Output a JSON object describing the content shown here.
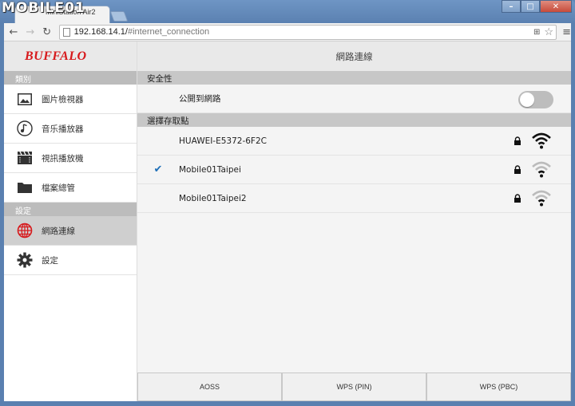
{
  "browser": {
    "watermark": "MOBILE01",
    "tab_title": "MiniStation Air2",
    "url_host": "192.168.14.1/",
    "url_path": "#internet_connection",
    "window_buttons": [
      "–",
      "□",
      "✕"
    ]
  },
  "sidebar": {
    "logo": "BUFFALO",
    "section_media": "類別",
    "section_settings": "設定",
    "items": [
      {
        "label": "圖片檢視器",
        "icon": "image-icon"
      },
      {
        "label": "音乐播放器",
        "icon": "music-note-icon"
      },
      {
        "label": "視訊播放機",
        "icon": "film-clapper-icon"
      },
      {
        "label": "檔案總管",
        "icon": "folder-icon"
      },
      {
        "label": "網路連線",
        "icon": "globe-icon",
        "active": true
      },
      {
        "label": "設定",
        "icon": "gear-icon"
      }
    ]
  },
  "main": {
    "title": "網路連線",
    "security_head": "安全性",
    "public_label": "公開到網路",
    "public_enabled": false,
    "ap_head": "選擇存取點",
    "access_points": [
      {
        "ssid": "HUAWEI-E5372-6F2C",
        "selected": false,
        "secured": true,
        "signal_bars": 3
      },
      {
        "ssid": "Mobile01Taipei",
        "selected": true,
        "secured": true,
        "signal_bars": 1
      },
      {
        "ssid": "Mobile01Taipei2",
        "selected": false,
        "secured": true,
        "signal_bars": 1
      }
    ],
    "buttons": {
      "aoss": "AOSS",
      "wps_pin": "WPS (PIN)",
      "wps_pbc": "WPS (PBC)"
    }
  },
  "colors": {
    "accent_check": "#1e6fb8",
    "logo": "#d7191c",
    "globe": "#d7191c"
  }
}
